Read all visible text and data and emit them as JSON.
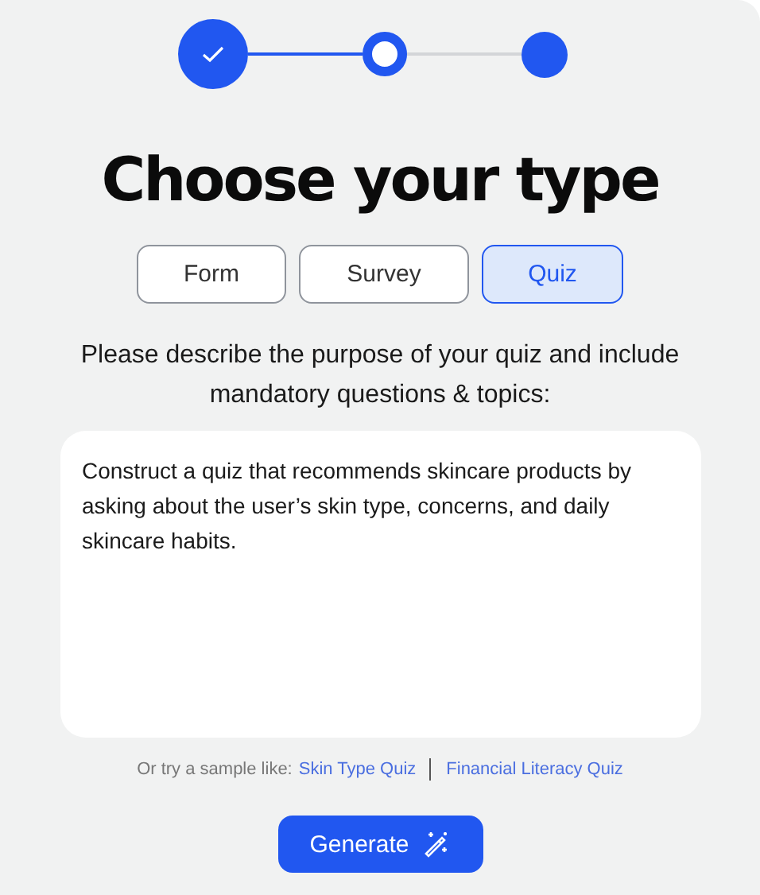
{
  "steps": [
    {
      "kind": "done"
    },
    {
      "kind": "current"
    },
    {
      "kind": "pending"
    }
  ],
  "title": "Choose your type",
  "types": [
    {
      "label": "Form",
      "selected": false
    },
    {
      "label": "Survey",
      "selected": false
    },
    {
      "label": "Quiz",
      "selected": true
    }
  ],
  "prompt": "Please describe the purpose of your quiz and include mandatory questions & topics:",
  "description": {
    "value": "Construct a quiz that recommends skincare products by asking about the user’s skin type, concerns, and daily skincare habits."
  },
  "samples": {
    "label": "Or try a sample like:",
    "links": [
      "Skin Type Quiz",
      "Financial Literacy Quiz"
    ]
  },
  "button": "Generate"
}
